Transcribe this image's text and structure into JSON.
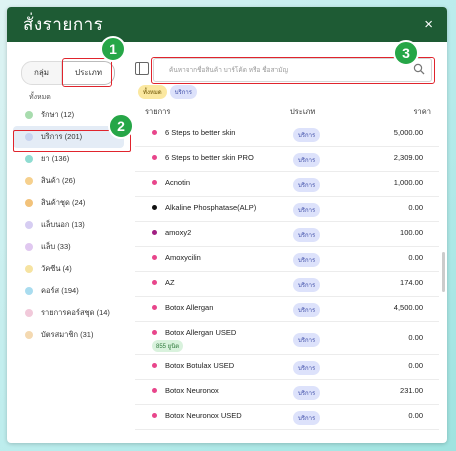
{
  "modal": {
    "title": "สั่งรายการ",
    "close_glyph": "×"
  },
  "sidebar": {
    "tab_group": "กลุ่ม",
    "tab_type": "ประเภท",
    "all_label": "ทั้งหมด",
    "categories": [
      {
        "label": "รักษา (12)",
        "color": "#a8dcae"
      },
      {
        "label": "บริการ (201)",
        "color": "#c7d3f0",
        "active": true
      },
      {
        "label": "ยา (136)",
        "color": "#8fdcd1"
      },
      {
        "label": "สินค้า (26)",
        "color": "#f6d08d"
      },
      {
        "label": "สินค้าชุด (24)",
        "color": "#f2c27a"
      },
      {
        "label": "แล็บนอก (13)",
        "color": "#d6cdf2"
      },
      {
        "label": "แล็บ (33)",
        "color": "#e0c8f0"
      },
      {
        "label": "วัคซีน (4)",
        "color": "#f6e3a1"
      },
      {
        "label": "คอร์ส (194)",
        "color": "#a9dcef"
      },
      {
        "label": "รายการคอร์สชุด (14)",
        "color": "#f1c9da"
      },
      {
        "label": "บัตรสมาชิก (31)",
        "color": "#f4d9b1"
      }
    ]
  },
  "search": {
    "placeholder": "ค้นหาจากชื่อสินค้า บาร์โค้ด หรือ ชื่อสามัญ"
  },
  "chips": {
    "all": "ทั้งหมด",
    "service": "บริการ"
  },
  "table": {
    "headers": {
      "item": "รายการ",
      "type": "ประเภท",
      "price": "ราคา"
    },
    "rows": [
      {
        "name": "6 Steps to better skin",
        "type": "บริการ",
        "price": "5,000.00",
        "dot": "#e8458b"
      },
      {
        "name": "6 Steps to better skin PRO",
        "type": "บริการ",
        "price": "2,309.00",
        "dot": "#e8458b"
      },
      {
        "name": "Acnotin",
        "type": "บริการ",
        "price": "1,000.00",
        "dot": "#e8458b"
      },
      {
        "name": "Alkaline Phosphatase(ALP)",
        "type": "บริการ",
        "price": "0.00",
        "dot": "#111111"
      },
      {
        "name": "amoxy2",
        "type": "บริการ",
        "price": "100.00",
        "dot": "#a01e82"
      },
      {
        "name": "Amoxycilin",
        "type": "บริการ",
        "price": "0.00",
        "dot": "#e8458b"
      },
      {
        "name": "AZ",
        "type": "บริการ",
        "price": "174.00",
        "dot": "#e8458b"
      },
      {
        "name": "Botox Allergan",
        "type": "บริการ",
        "price": "4,500.00",
        "dot": "#e8458b"
      },
      {
        "name": "Botox Allergan USED",
        "type": "บริการ",
        "price": "0.00",
        "dot": "#e8458b",
        "sub": "855 ยูนิต"
      },
      {
        "name": "Botox Botulax USED",
        "type": "บริการ",
        "price": "0.00",
        "dot": "#e8458b"
      },
      {
        "name": "Botox Neuronox",
        "type": "บริการ",
        "price": "231.00",
        "dot": "#e8458b"
      },
      {
        "name": "Botox Neuronox USED",
        "type": "บริการ",
        "price": "0.00",
        "dot": "#e8458b"
      }
    ]
  },
  "markers": {
    "one": "1",
    "two": "2",
    "three": "3"
  }
}
